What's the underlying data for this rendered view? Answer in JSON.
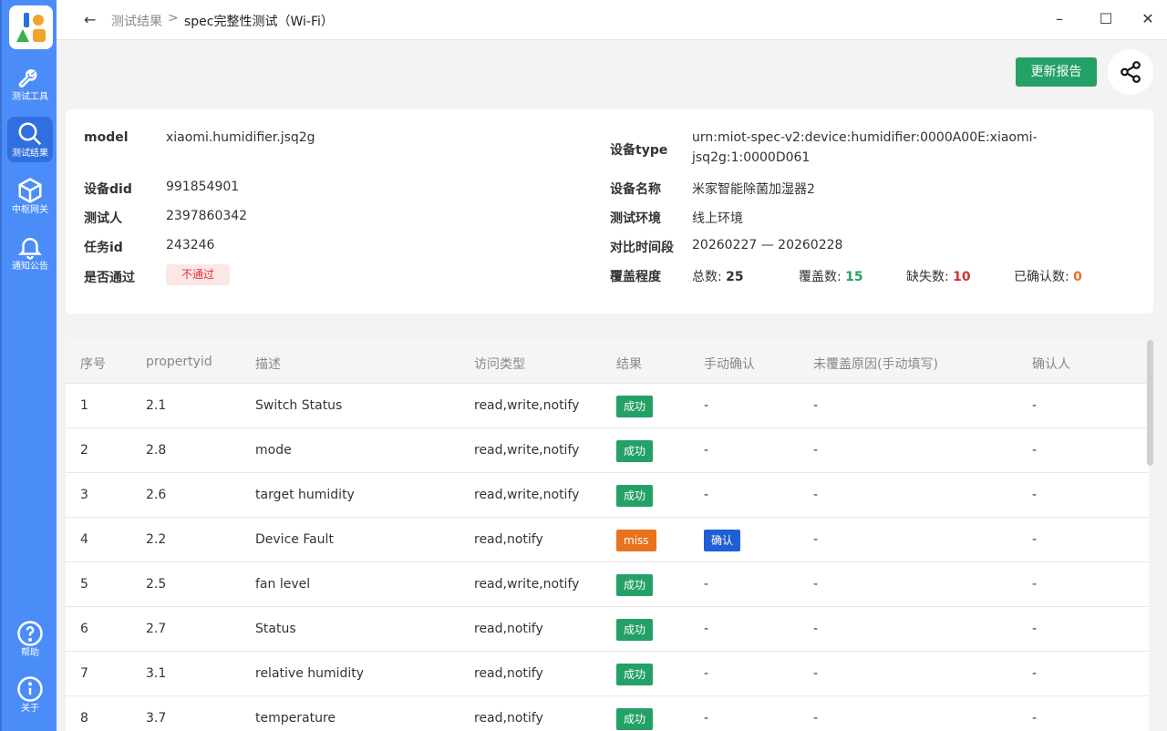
{
  "sidebar": {
    "items": [
      {
        "label": "测试工具",
        "icon": "wrench-icon"
      },
      {
        "label": "测试结果",
        "icon": "search-icon"
      },
      {
        "label": "中枢网关",
        "icon": "cube-icon"
      },
      {
        "label": "通知公告",
        "icon": "bell-icon"
      },
      {
        "label": "帮助",
        "icon": "help-icon"
      },
      {
        "label": "关于",
        "icon": "info-icon"
      }
    ],
    "active": "测试结果"
  },
  "titlebar": {
    "breadcrumb_parent": "测试结果",
    "breadcrumb_sep": ">",
    "breadcrumb_current": "spec完整性测试（Wi-Fi）"
  },
  "actions": {
    "update_label": "更新报告"
  },
  "info": {
    "model_label": "model",
    "model_value": "xiaomi.humidifier.jsq2g",
    "did_label": "设备did",
    "did_value": "991854901",
    "tester_label": "测试人",
    "tester_value": "2397860342",
    "task_label": "任务id",
    "task_value": "243246",
    "pass_label": "是否通过",
    "pass_value": "不通过",
    "type_label": "设备type",
    "type_value": "urn:miot-spec-v2:device:humidifier:0000A00E:xiaomi-jsq2g:1:0000D061",
    "name_label": "设备名称",
    "name_value": "米家智能除菌加湿器2",
    "env_label": "测试环境",
    "env_value": "线上环境",
    "compare_label": "对比时间段",
    "compare_value": "20260227 — 20260228",
    "coverage_label": "覆盖程度",
    "total_label": "总数:",
    "total_value": "25",
    "covered_label": "覆盖数:",
    "covered_value": "15",
    "missing_label": "缺失数:",
    "missing_value": "10",
    "confirmed_label": "已确认数:",
    "confirmed_value": "0"
  },
  "colors": {
    "success": "#23a167",
    "miss": "#e8731f",
    "confirm": "#1f5fd6",
    "fail_text": "#d33333",
    "covered_text": "#23a167",
    "missing_text": "#d33333",
    "confirmed_text": "#e8731f",
    "sidebar": "#4b8df8"
  },
  "table": {
    "headers": [
      "序号",
      "propertyid",
      "描述",
      "访问类型",
      "结果",
      "手动确认",
      "未覆盖原因(手动填写)",
      "确认人"
    ],
    "rows": [
      {
        "no": "1",
        "pid": "2.1",
        "desc": "Switch Status",
        "access": "read,write,notify",
        "result": "成功",
        "manual": "-",
        "reason": "-",
        "confirmer": "-"
      },
      {
        "no": "2",
        "pid": "2.8",
        "desc": "mode",
        "access": "read,write,notify",
        "result": "成功",
        "manual": "-",
        "reason": "-",
        "confirmer": "-"
      },
      {
        "no": "3",
        "pid": "2.6",
        "desc": "target humidity",
        "access": "read,write,notify",
        "result": "成功",
        "manual": "-",
        "reason": "-",
        "confirmer": "-"
      },
      {
        "no": "4",
        "pid": "2.2",
        "desc": "Device Fault",
        "access": "read,notify",
        "result": "miss",
        "manual": "确认",
        "reason": "-",
        "confirmer": "-"
      },
      {
        "no": "5",
        "pid": "2.5",
        "desc": "fan level",
        "access": "read,write,notify",
        "result": "成功",
        "manual": "-",
        "reason": "-",
        "confirmer": "-"
      },
      {
        "no": "6",
        "pid": "2.7",
        "desc": "Status",
        "access": "read,notify",
        "result": "成功",
        "manual": "-",
        "reason": "-",
        "confirmer": "-"
      },
      {
        "no": "7",
        "pid": "3.1",
        "desc": "relative humidity",
        "access": "read,notify",
        "result": "成功",
        "manual": "-",
        "reason": "-",
        "confirmer": "-"
      },
      {
        "no": "8",
        "pid": "3.7",
        "desc": "temperature",
        "access": "read,notify",
        "result": "成功",
        "manual": "-",
        "reason": "-",
        "confirmer": "-"
      }
    ]
  }
}
